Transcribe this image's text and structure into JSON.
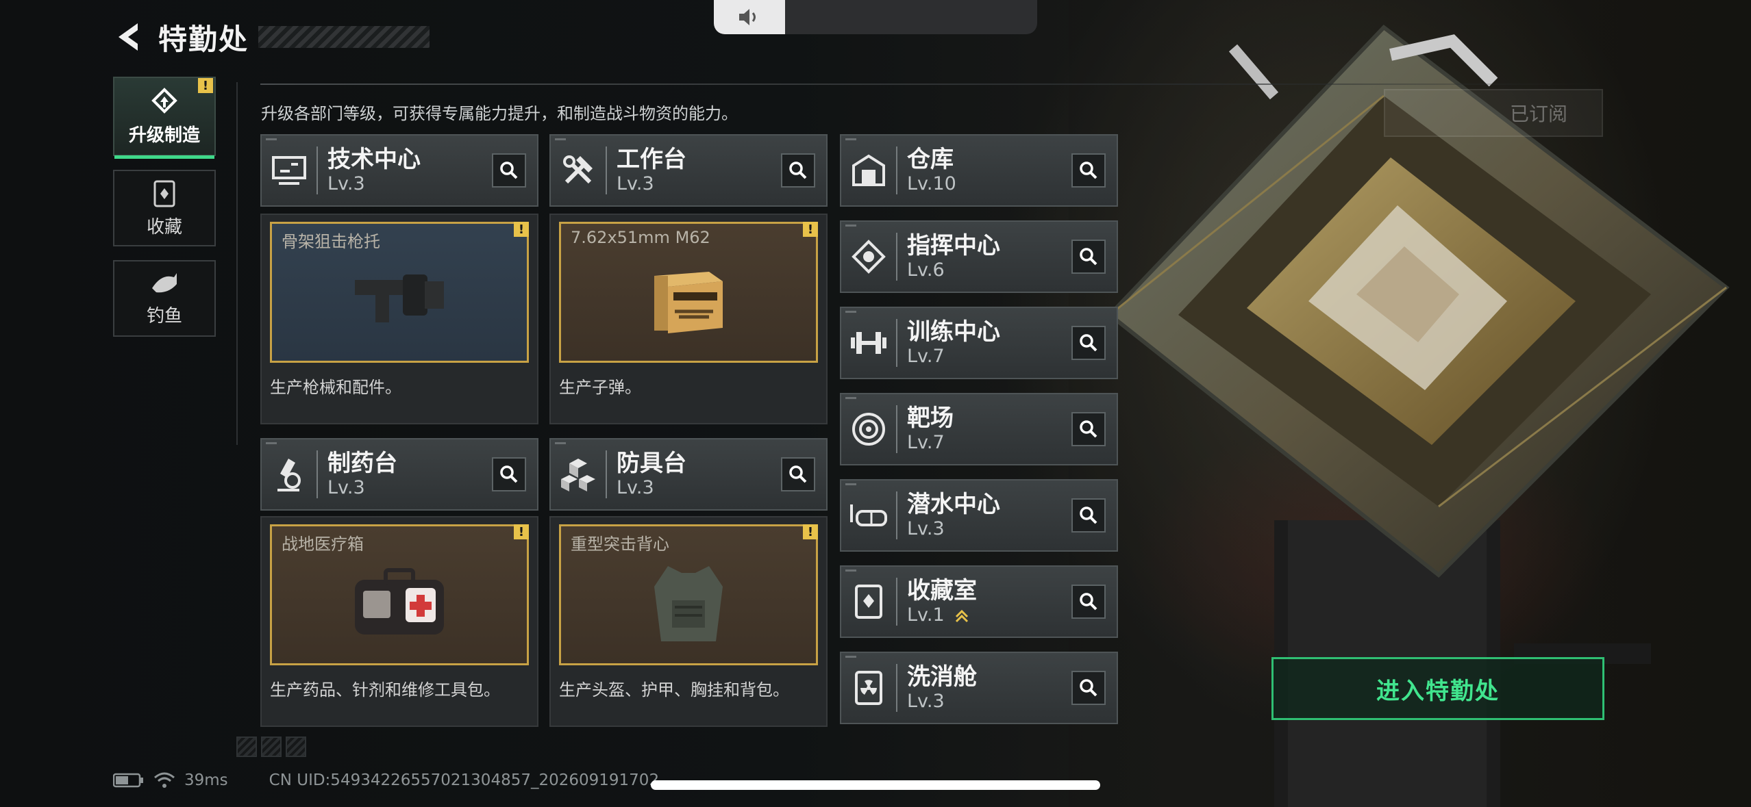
{
  "page": {
    "title": "特勤处",
    "description": "升级各部门等级，可获得专属能力提升，和制造战斗物资的能力。"
  },
  "sidebar": {
    "items": [
      {
        "label": "升级制造",
        "active": true,
        "badge": "!"
      },
      {
        "label": "收藏"
      },
      {
        "label": "钓鱼"
      }
    ]
  },
  "departments": {
    "tech": {
      "name": "技术中心",
      "level": "Lv.3",
      "product": "骨架狙击枪托",
      "desc": "生产枪械和配件。",
      "badge": "!"
    },
    "workbench": {
      "name": "工作台",
      "level": "Lv.3",
      "product": "7.62x51mm M62",
      "desc": "生产子弹。",
      "badge": "!"
    },
    "pharmacy": {
      "name": "制药台",
      "level": "Lv.3",
      "product": "战地医疗箱",
      "desc": "生产药品、针剂和维修工具包。",
      "badge": "!"
    },
    "armor": {
      "name": "防具台",
      "level": "Lv.3",
      "product": "重型突击背心",
      "desc": "生产头盔、护甲、胸挂和背包。",
      "badge": "!"
    },
    "warehouse": {
      "name": "仓库",
      "level": "Lv.10"
    },
    "command": {
      "name": "指挥中心",
      "level": "Lv.6"
    },
    "training": {
      "name": "训练中心",
      "level": "Lv.7"
    },
    "range": {
      "name": "靶场",
      "level": "Lv.7"
    },
    "diving": {
      "name": "潜水中心",
      "level": "Lv.3"
    },
    "collection": {
      "name": "收藏室",
      "level": "Lv.1"
    },
    "decon": {
      "name": "洗消舱",
      "level": "Lv.3"
    }
  },
  "actions": {
    "enter": "进入特勤处",
    "subscribed": "已订阅"
  },
  "status": {
    "ping": "39ms",
    "uid": "CN UID:5493422655702130​4857_202609191702"
  },
  "colors": {
    "accent": "#3fd98a",
    "badge": "#e8c24a",
    "frame": "#c8a245"
  }
}
